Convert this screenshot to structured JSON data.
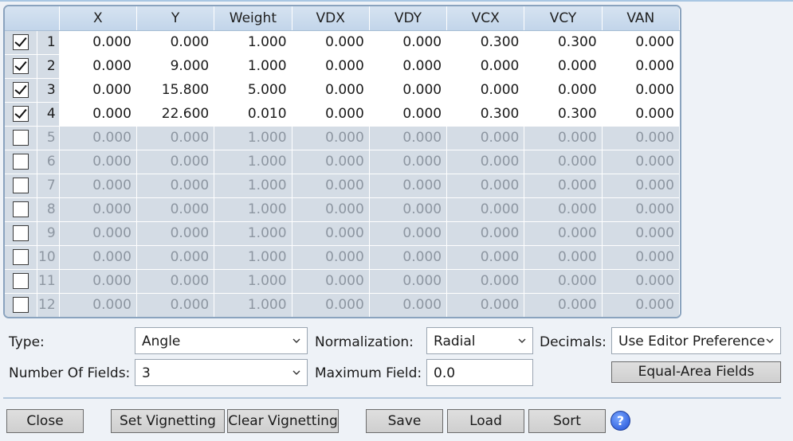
{
  "table": {
    "columns": [
      "X",
      "Y",
      "Weight",
      "VDX",
      "VDY",
      "VCX",
      "VCY",
      "VAN"
    ],
    "rows": [
      {
        "n": "1",
        "checked": true,
        "values": [
          "0.000",
          "0.000",
          "1.000",
          "0.000",
          "0.000",
          "0.300",
          "0.300",
          "0.000"
        ]
      },
      {
        "n": "2",
        "checked": true,
        "values": [
          "0.000",
          "9.000",
          "1.000",
          "0.000",
          "0.000",
          "0.000",
          "0.000",
          "0.000"
        ]
      },
      {
        "n": "3",
        "checked": true,
        "values": [
          "0.000",
          "15.800",
          "5.000",
          "0.000",
          "0.000",
          "0.000",
          "0.000",
          "0.000"
        ]
      },
      {
        "n": "4",
        "checked": true,
        "values": [
          "0.000",
          "22.600",
          "0.010",
          "0.000",
          "0.000",
          "0.300",
          "0.300",
          "0.000"
        ]
      },
      {
        "n": "5",
        "checked": false,
        "values": [
          "0.000",
          "0.000",
          "1.000",
          "0.000",
          "0.000",
          "0.000",
          "0.000",
          "0.000"
        ]
      },
      {
        "n": "6",
        "checked": false,
        "values": [
          "0.000",
          "0.000",
          "1.000",
          "0.000",
          "0.000",
          "0.000",
          "0.000",
          "0.000"
        ]
      },
      {
        "n": "7",
        "checked": false,
        "values": [
          "0.000",
          "0.000",
          "1.000",
          "0.000",
          "0.000",
          "0.000",
          "0.000",
          "0.000"
        ]
      },
      {
        "n": "8",
        "checked": false,
        "values": [
          "0.000",
          "0.000",
          "1.000",
          "0.000",
          "0.000",
          "0.000",
          "0.000",
          "0.000"
        ]
      },
      {
        "n": "9",
        "checked": false,
        "values": [
          "0.000",
          "0.000",
          "1.000",
          "0.000",
          "0.000",
          "0.000",
          "0.000",
          "0.000"
        ]
      },
      {
        "n": "10",
        "checked": false,
        "values": [
          "0.000",
          "0.000",
          "1.000",
          "0.000",
          "0.000",
          "0.000",
          "0.000",
          "0.000"
        ]
      },
      {
        "n": "11",
        "checked": false,
        "values": [
          "0.000",
          "0.000",
          "1.000",
          "0.000",
          "0.000",
          "0.000",
          "0.000",
          "0.000"
        ]
      },
      {
        "n": "12",
        "checked": false,
        "values": [
          "0.000",
          "0.000",
          "1.000",
          "0.000",
          "0.000",
          "0.000",
          "0.000",
          "0.000"
        ]
      }
    ]
  },
  "settings": {
    "type_label": "Type:",
    "type_value": "Angle",
    "normalization_label": "Normalization:",
    "normalization_value": "Radial",
    "decimals_label": "Decimals:",
    "decimals_value": "Use Editor Preference",
    "num_fields_label": "Number Of Fields:",
    "num_fields_value": "3",
    "max_field_label": "Maximum Field:",
    "max_field_value": "0.0",
    "equal_area_label": "Equal-Area Fields"
  },
  "buttons": {
    "close": "Close",
    "set_vignetting": "Set Vignetting",
    "clear_vignetting": "Clear Vignetting",
    "save": "Save",
    "load": "Load",
    "sort": "Sort",
    "help": "?"
  },
  "icons": {
    "dropdown": "chevron-down-icon",
    "help": "help-icon"
  },
  "colors": {
    "header": "#c9d9ec",
    "disabled_row": "#d4dce5",
    "help_blue": "#1f4fd6"
  }
}
